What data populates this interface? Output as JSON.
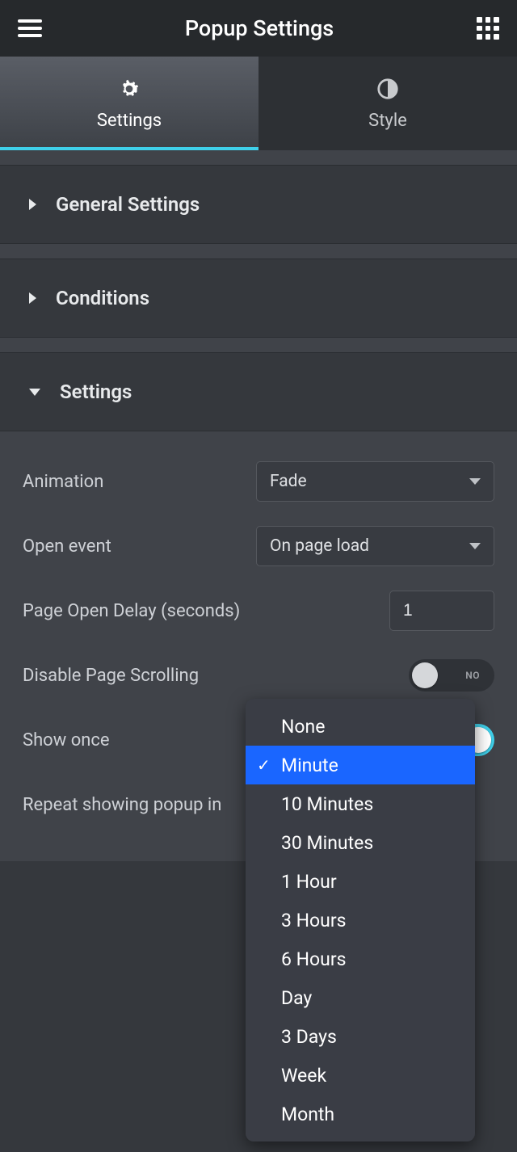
{
  "header": {
    "title": "Popup Settings"
  },
  "tabs": {
    "settings": "Settings",
    "style": "Style"
  },
  "sections": {
    "general": "General Settings",
    "conditions": "Conditions",
    "settings": "Settings"
  },
  "fields": {
    "animation": {
      "label": "Animation",
      "value": "Fade"
    },
    "openEvent": {
      "label": "Open event",
      "value": "On page load"
    },
    "pageOpenDelay": {
      "label": "Page Open Delay (seconds)",
      "value": "1"
    },
    "disableScrolling": {
      "label": "Disable Page Scrolling",
      "value": "NO"
    },
    "showOnce": {
      "label": "Show once",
      "value": "YES"
    },
    "repeat": {
      "label": "Repeat showing popup in"
    }
  },
  "dropdown": {
    "options": [
      "None",
      "Minute",
      "10 Minutes",
      "30 Minutes",
      "1 Hour",
      "3 Hours",
      "6 Hours",
      "Day",
      "3 Days",
      "Week",
      "Month"
    ],
    "selected": "Minute"
  }
}
